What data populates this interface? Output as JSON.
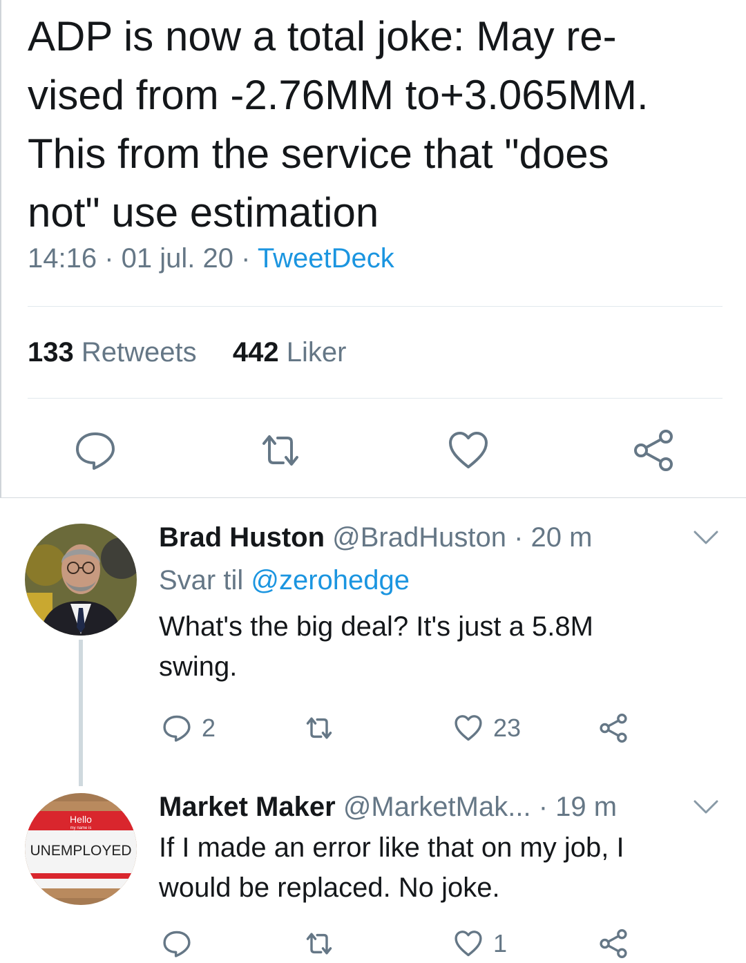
{
  "main_tweet": {
    "text_lines": [
      "ADP is now a total joke: May re-",
      "vised from -2.76MM to+3.065MM.",
      "This from the service that \"does",
      "not\" use estimation"
    ],
    "time": "14:16",
    "date": "01 jul. 20",
    "source": "TweetDeck",
    "retweets_count": "133",
    "retweets_label": "Retweets",
    "likes_count": "442",
    "likes_label": "Liker"
  },
  "replies": [
    {
      "name": "Brad Huston",
      "handle": "@BradHuston",
      "time": "20 m",
      "reply_to_label": "Svar til",
      "reply_to_handle": "@zerohedge",
      "text_lines": [
        "What's the big deal?  It's just a 5.8M",
        "swing."
      ],
      "reply_count": "2",
      "retweet_count": "",
      "like_count": "23"
    },
    {
      "name": "Market Maker",
      "handle": "@MarketMak...",
      "time": "19 m",
      "text_lines": [
        "If I made an error like that on my job, I",
        "would be replaced.  No joke."
      ],
      "reply_count": "",
      "retweet_count": "",
      "like_count": "1",
      "avatar_badge": {
        "top": "Hello",
        "sub": "my name is",
        "word": "UNEMPLOYED"
      }
    }
  ],
  "colors": {
    "text": "#14171a",
    "secondary": "#657786",
    "link": "#1b95e0",
    "divider": "#e1e8ed"
  },
  "icons": [
    "reply-icon",
    "retweet-icon",
    "like-icon",
    "share-icon",
    "chevron-down-icon"
  ]
}
